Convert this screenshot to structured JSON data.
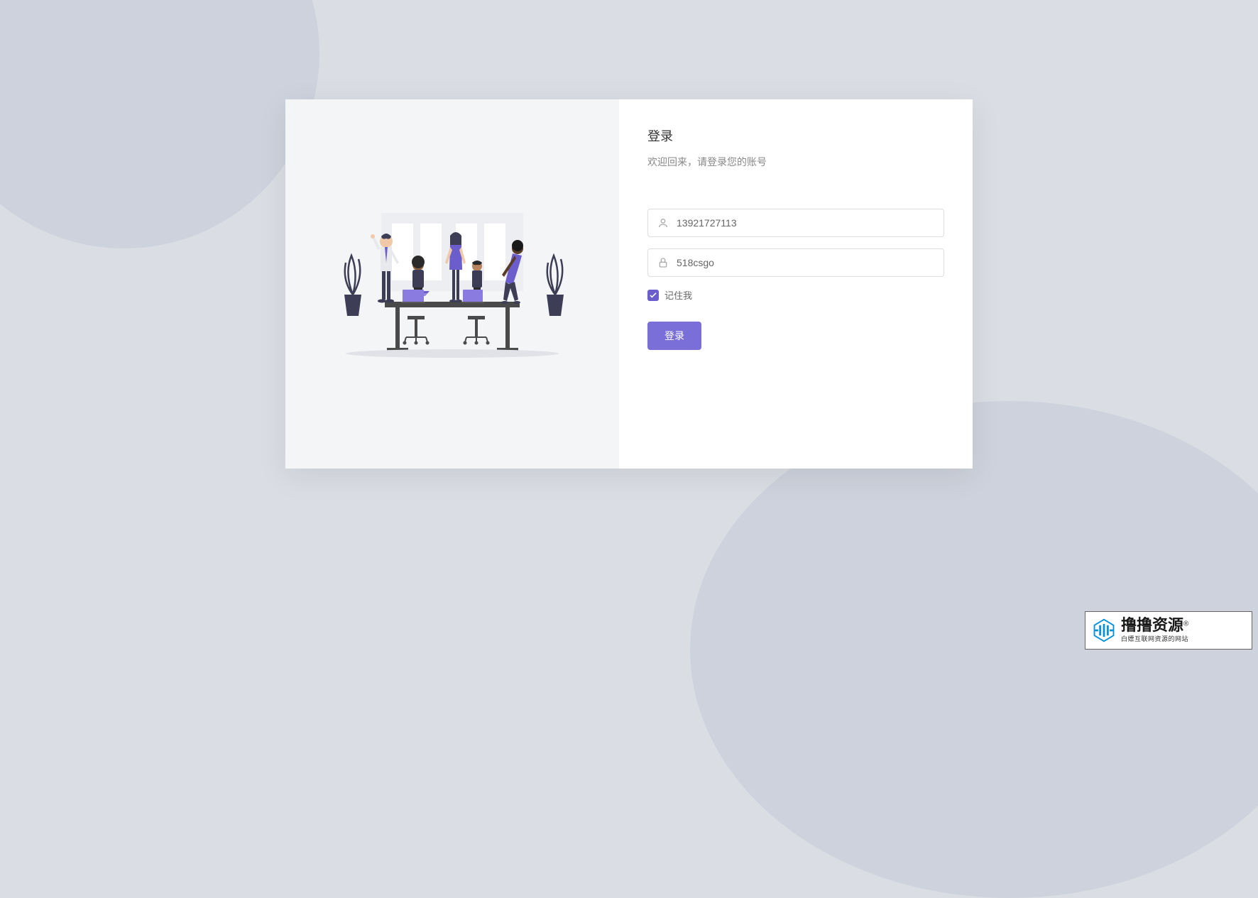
{
  "login": {
    "title": "登录",
    "subtitle": "欢迎回来，请登录您的账号",
    "username_value": "13921727113",
    "password_value": "518csgo",
    "remember_label": "记住我",
    "remember_checked": true,
    "submit_label": "登录"
  },
  "watermark": {
    "main": "撸撸资源",
    "registered": "®",
    "sub": "白嫖互联网资源的网站"
  },
  "colors": {
    "accent": "#7a6ed8",
    "bg": "#dadde4",
    "bg_shape": "#ced2dc"
  }
}
